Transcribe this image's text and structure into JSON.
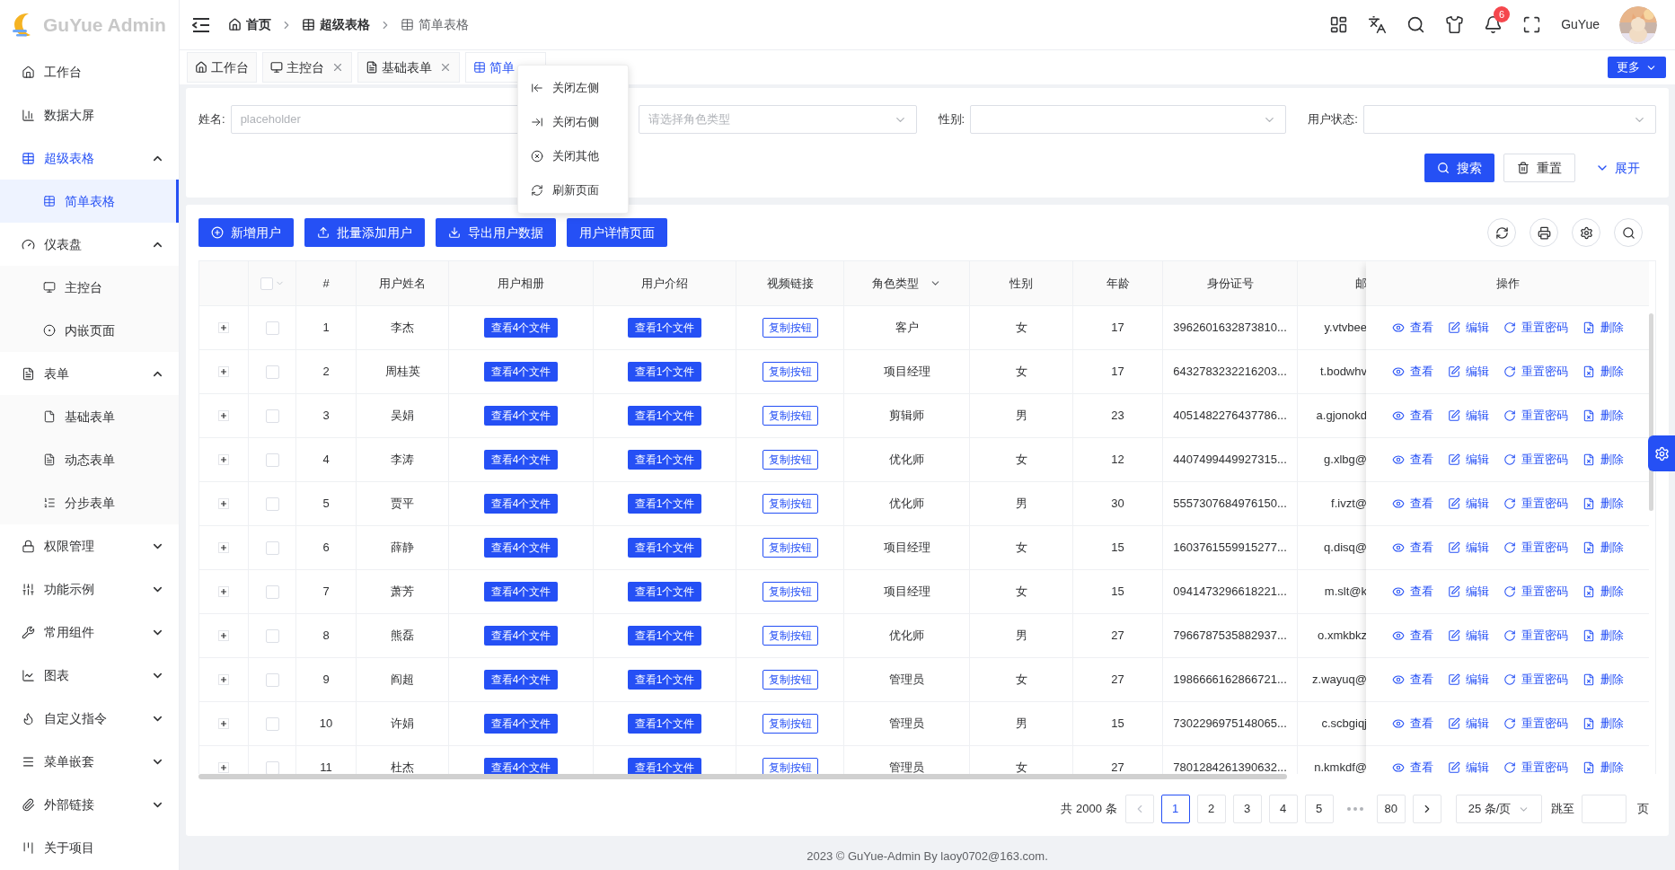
{
  "sidebar": {
    "logo": "GuYue Admin",
    "items": [
      {
        "label": "工作台",
        "selected": false
      },
      {
        "label": "数据大屏",
        "selected": false
      },
      {
        "label": "超级表格",
        "selected": false,
        "expanded": true,
        "children": [
          {
            "label": "简单表格",
            "selected": true
          }
        ]
      },
      {
        "label": "仪表盘",
        "selected": false,
        "expanded": true,
        "children": [
          {
            "label": "主控台",
            "selected": false
          },
          {
            "label": "内嵌页面",
            "selected": false
          }
        ]
      },
      {
        "label": "表单",
        "selected": false,
        "expanded": true,
        "children": [
          {
            "label": "基础表单",
            "selected": false
          },
          {
            "label": "动态表单",
            "selected": false
          },
          {
            "label": "分步表单",
            "selected": false
          }
        ]
      },
      {
        "label": "权限管理",
        "selected": false,
        "expanded": false
      },
      {
        "label": "功能示例",
        "selected": false,
        "expanded": false
      },
      {
        "label": "常用组件",
        "selected": false,
        "expanded": false
      },
      {
        "label": "图表",
        "selected": false,
        "expanded": false
      },
      {
        "label": "自定义指令",
        "selected": false,
        "expanded": false
      },
      {
        "label": "菜单嵌套",
        "selected": false,
        "expanded": false
      },
      {
        "label": "外部链接",
        "selected": false,
        "expanded": false
      },
      {
        "label": "关于项目",
        "selected": false
      }
    ]
  },
  "header": {
    "breadcrumb": [
      {
        "label": "首页",
        "current": false
      },
      {
        "label": "超级表格",
        "current": false
      },
      {
        "label": "简单表格",
        "current": true
      }
    ],
    "user_name": "GuYue",
    "notification_count": "6"
  },
  "tabs": {
    "items": [
      {
        "label": "工作台",
        "selected": false,
        "closable": false
      },
      {
        "label": "主控台",
        "selected": false,
        "closable": true
      },
      {
        "label": "基础表单",
        "selected": false,
        "closable": true
      },
      {
        "label": "简单",
        "selected": true
      }
    ],
    "more_button": "更多"
  },
  "tab_menu": [
    "关闭左侧",
    "关闭右侧",
    "关闭其他",
    "刷新页面"
  ],
  "search_form": {
    "fields": [
      {
        "label": "姓名:",
        "kind": "input",
        "placeholder": "placeholder"
      },
      {
        "kind": "select",
        "placeholder": "请选择角色类型"
      },
      {
        "label": "性别:",
        "kind": "select"
      },
      {
        "label": "用户状态:",
        "kind": "select"
      }
    ],
    "search_button": "搜索",
    "reset_button": "重置",
    "expand_link": "展开"
  },
  "toolbar": {
    "buttons": [
      "新增用户",
      "批量添加用户",
      "导出用户数据",
      "用户详情页面"
    ]
  },
  "table": {
    "columns": [
      "#",
      "用户姓名",
      "用户相册",
      "用户介绍",
      "视频链接",
      "角色类型",
      "性别",
      "年龄",
      "身份证号",
      "邮",
      "操作"
    ],
    "select_all_checked": false,
    "rows": [
      {
        "checked": false,
        "no": "1",
        "name": "李杰",
        "album": "查看4个文件",
        "intro": "查看1个文件",
        "video": "复制按钮",
        "role": "客户",
        "gender": "女",
        "age": "17",
        "id": "3962601632873810...",
        "email": "y.vtvbee",
        "actions": [
          "查看",
          "编辑",
          "重置密码",
          "删除"
        ]
      },
      {
        "checked": false,
        "no": "2",
        "name": "周桂英",
        "album": "查看4个文件",
        "intro": "查看1个文件",
        "video": "复制按钮",
        "role": "项目经理",
        "gender": "女",
        "age": "17",
        "id": "6432783232216203...",
        "email": "t.bodwhv",
        "actions": [
          "查看",
          "编辑",
          "重置密码",
          "删除"
        ]
      },
      {
        "checked": false,
        "no": "3",
        "name": "吴娟",
        "album": "查看4个文件",
        "intro": "查看1个文件",
        "video": "复制按钮",
        "role": "剪辑师",
        "gender": "男",
        "age": "23",
        "id": "4051482276437786...",
        "email": "a.gjonokd",
        "actions": [
          "查看",
          "编辑",
          "重置密码",
          "删除"
        ]
      },
      {
        "checked": false,
        "no": "4",
        "name": "李涛",
        "album": "查看4个文件",
        "intro": "查看1个文件",
        "video": "复制按钮",
        "role": "优化师",
        "gender": "女",
        "age": "12",
        "id": "4407499449927315...",
        "email": "g.xlbg@",
        "actions": [
          "查看",
          "编辑",
          "重置密码",
          "删除"
        ]
      },
      {
        "checked": false,
        "no": "5",
        "name": "贾平",
        "album": "查看4个文件",
        "intro": "查看1个文件",
        "video": "复制按钮",
        "role": "优化师",
        "gender": "男",
        "age": "30",
        "id": "5557307684976150...",
        "email": "f.ivzt@",
        "actions": [
          "查看",
          "编辑",
          "重置密码",
          "删除"
        ]
      },
      {
        "checked": false,
        "no": "6",
        "name": "薛静",
        "album": "查看4个文件",
        "intro": "查看1个文件",
        "video": "复制按钮",
        "role": "项目经理",
        "gender": "女",
        "age": "15",
        "id": "1603761559915277...",
        "email": "q.disq@",
        "actions": [
          "查看",
          "编辑",
          "重置密码",
          "删除"
        ]
      },
      {
        "checked": false,
        "no": "7",
        "name": "萧芳",
        "album": "查看4个文件",
        "intro": "查看1个文件",
        "video": "复制按钮",
        "role": "项目经理",
        "gender": "女",
        "age": "15",
        "id": "0941473296618221...",
        "email": "m.slt@k",
        "actions": [
          "查看",
          "编辑",
          "重置密码",
          "删除"
        ]
      },
      {
        "checked": false,
        "no": "8",
        "name": "熊磊",
        "album": "查看4个文件",
        "intro": "查看1个文件",
        "video": "复制按钮",
        "role": "优化师",
        "gender": "男",
        "age": "27",
        "id": "7966787535882937...",
        "email": "o.xmkbkz",
        "actions": [
          "查看",
          "编辑",
          "重置密码",
          "删除"
        ]
      },
      {
        "checked": false,
        "no": "9",
        "name": "阎超",
        "album": "查看4个文件",
        "intro": "查看1个文件",
        "video": "复制按钮",
        "role": "管理员",
        "gender": "女",
        "age": "27",
        "id": "1986666162866721...",
        "email": "z.wayuq@",
        "actions": [
          "查看",
          "编辑",
          "重置密码",
          "删除"
        ]
      },
      {
        "checked": false,
        "no": "10",
        "name": "许娟",
        "album": "查看4个文件",
        "intro": "查看1个文件",
        "video": "复制按钮",
        "role": "管理员",
        "gender": "男",
        "age": "15",
        "id": "7302296975148065...",
        "email": "c.scbgiqj",
        "actions": [
          "查看",
          "编辑",
          "重置密码",
          "删除"
        ]
      },
      {
        "checked": false,
        "no": "11",
        "name": "杜杰",
        "album": "查看4个文件",
        "intro": "查看1个文件",
        "video": "复制按钮",
        "role": "管理员",
        "gender": "女",
        "age": "27",
        "id": "7801284261390632...",
        "email": "n.kmkdf@",
        "actions": [
          "查看",
          "编辑",
          "重置密码",
          "删除"
        ]
      }
    ]
  },
  "pagination": {
    "total": "共 2000 条",
    "prev_disabled": true,
    "pages": [
      {
        "kind": "page",
        "label": "1",
        "selected": true
      },
      {
        "kind": "page",
        "label": "2",
        "selected": false
      },
      {
        "kind": "page",
        "label": "3",
        "selected": false
      },
      {
        "kind": "page",
        "label": "4",
        "selected": false
      },
      {
        "kind": "page",
        "label": "5",
        "selected": false
      },
      {
        "kind": "ellipsis"
      },
      {
        "kind": "page",
        "label": "80",
        "selected": false
      }
    ],
    "page_size": "25 条/页",
    "jump_label": "跳至",
    "page_suffix": "页"
  },
  "footer": "2023 © GuYue-Admin By laoy0702@163.com."
}
